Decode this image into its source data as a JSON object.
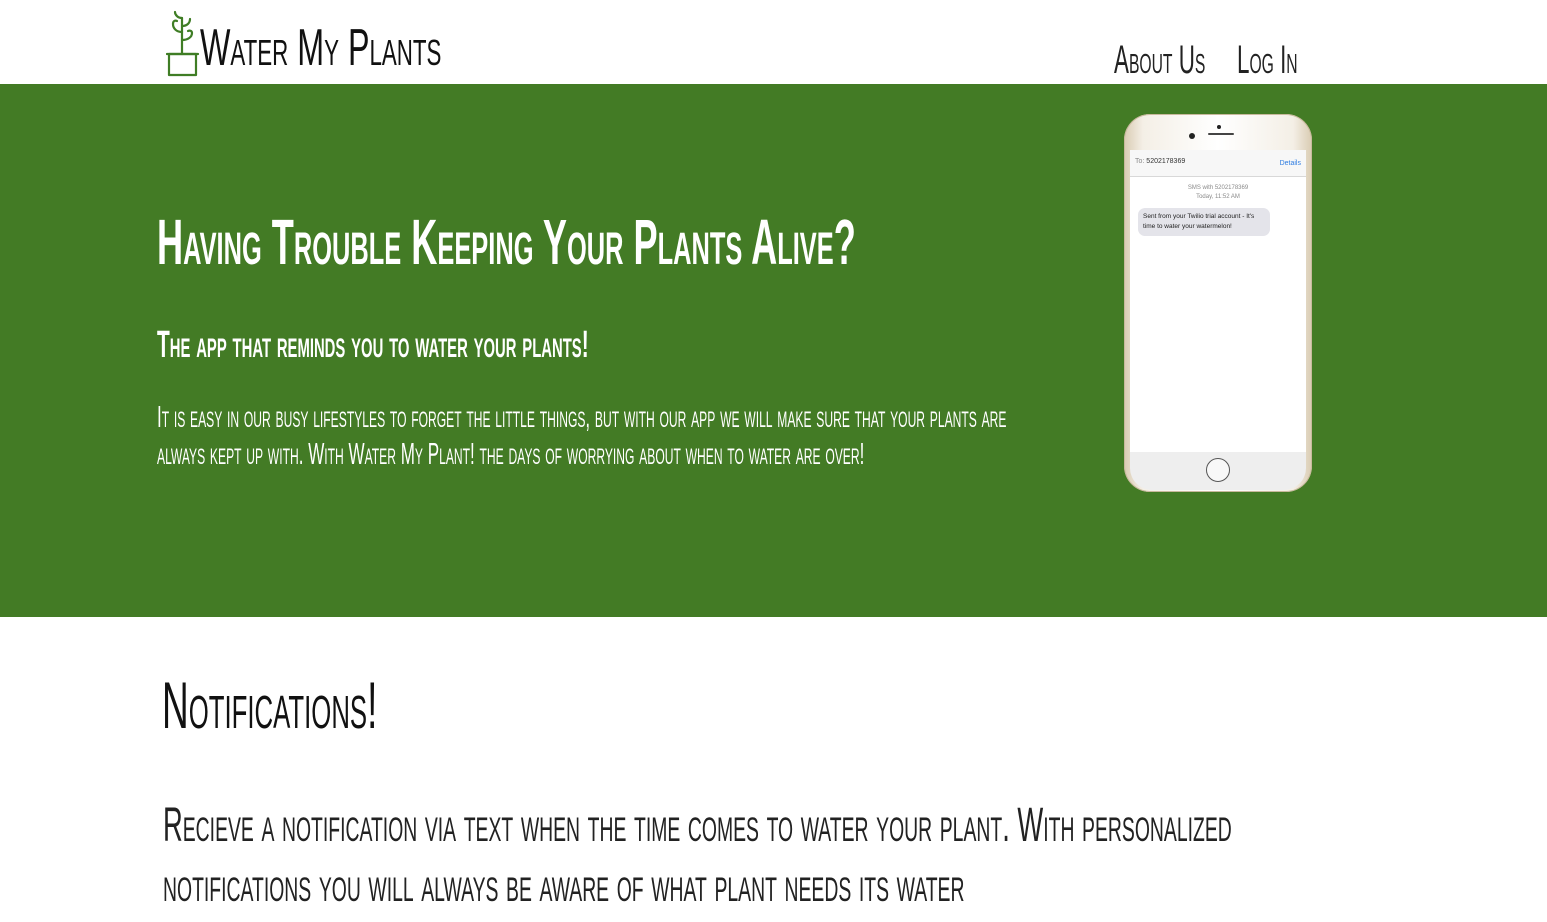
{
  "header": {
    "logo_text": "Water My Plants",
    "nav": {
      "about_label": "About Us",
      "login_label": "Log In"
    }
  },
  "hero": {
    "title": "Having Trouble Keeping Your Plants Alive?",
    "subtitle": "The app that reminds you to water your plants!",
    "description": "It is easy in our busy lifestyles to forget the little things, but with our app we will make sure that your plants are always kept up with. With Water My Plant! the days of worrying about when to water are over!",
    "background_color": "#437b25"
  },
  "phone": {
    "to_label": "To:",
    "to_number": "5202178369",
    "details_label": "Details",
    "sms_meta_line1": "SMS with 5202178369",
    "sms_meta_line2": "Today, 11:52 AM",
    "message": "Sent from your Twilio trial account - It's time to water your watermelon!"
  },
  "notifications": {
    "title": "Notifications!",
    "text": "Recieve a notification via text when the time comes to water your plant. With personalized notifications you will always be aware of what plant needs its water"
  },
  "icons": {
    "logo": "plant-pot-icon"
  }
}
